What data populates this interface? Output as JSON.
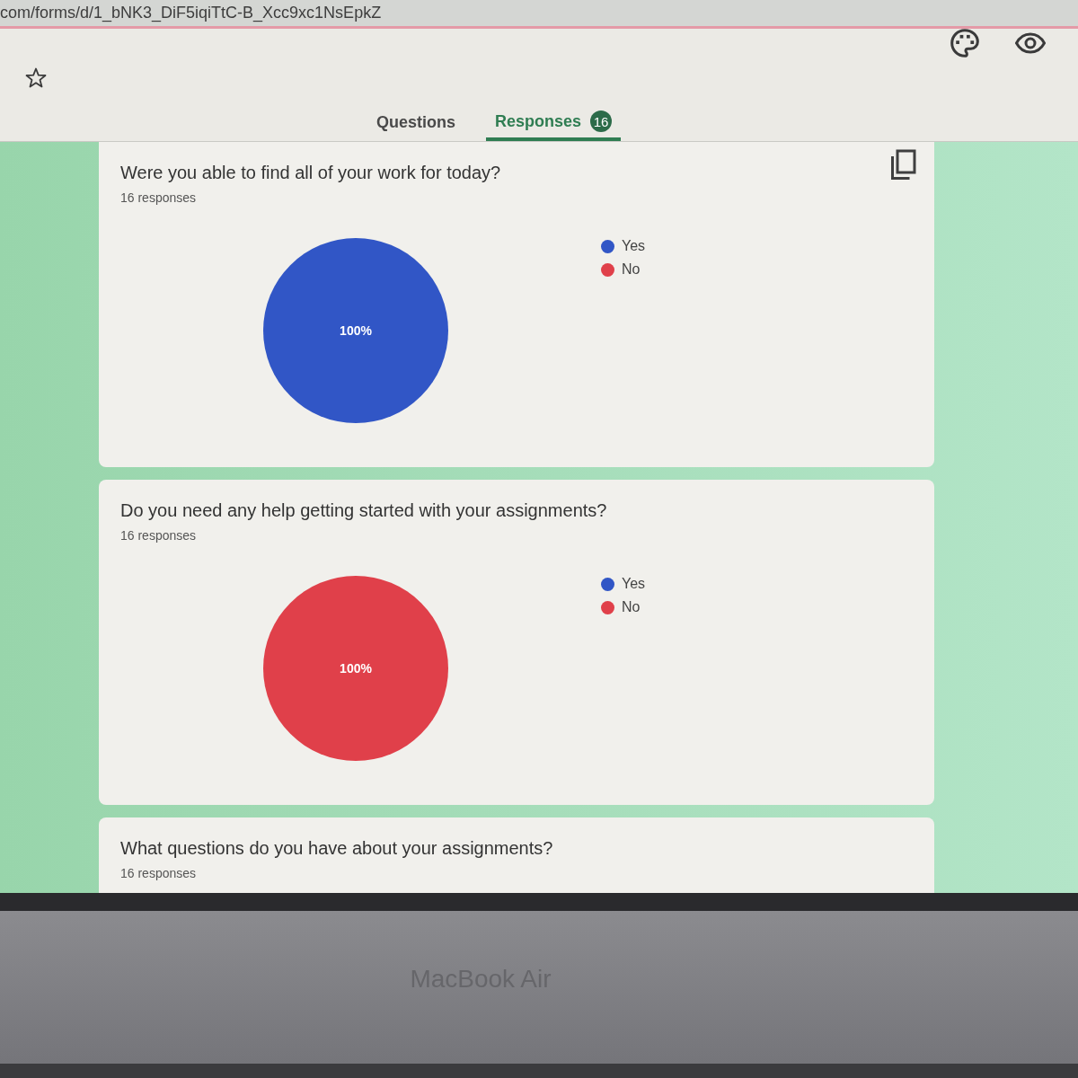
{
  "browser": {
    "url": "com/forms/d/1_bNK3_DiF5iqiTtC-B_Xcc9xc1NsEpkZ"
  },
  "tabs": [
    {
      "label": "Questions",
      "selected": false
    },
    {
      "label": "Responses",
      "selected": true,
      "badge": "16"
    }
  ],
  "cards": [
    {
      "question": "Were you able to find all of your work for today?",
      "responses": "16 responses",
      "copy_chart": true,
      "chart_data": {
        "type": "pie",
        "values": [
          100,
          0
        ],
        "value_labels": [
          "100%",
          null
        ]
      },
      "legend": [
        {
          "label": "Yes",
          "color": "#3156c6"
        },
        {
          "label": "No",
          "color": "#e0404a"
        }
      ]
    },
    {
      "question": "Do you need any help getting started with your assignments?",
      "responses": "16 responses",
      "copy_chart": false,
      "chart_data": {
        "type": "pie",
        "values": [
          0,
          100
        ],
        "value_labels": [
          null,
          "100%"
        ]
      },
      "legend": [
        {
          "label": "Yes",
          "color": "#3156c6"
        },
        {
          "label": "No",
          "color": "#e0404a"
        }
      ]
    },
    {
      "question": "What questions do you have about your assignments?",
      "responses": "16 responses",
      "copy_chart": false
    }
  ],
  "device": {
    "label": "MacBook Air"
  }
}
